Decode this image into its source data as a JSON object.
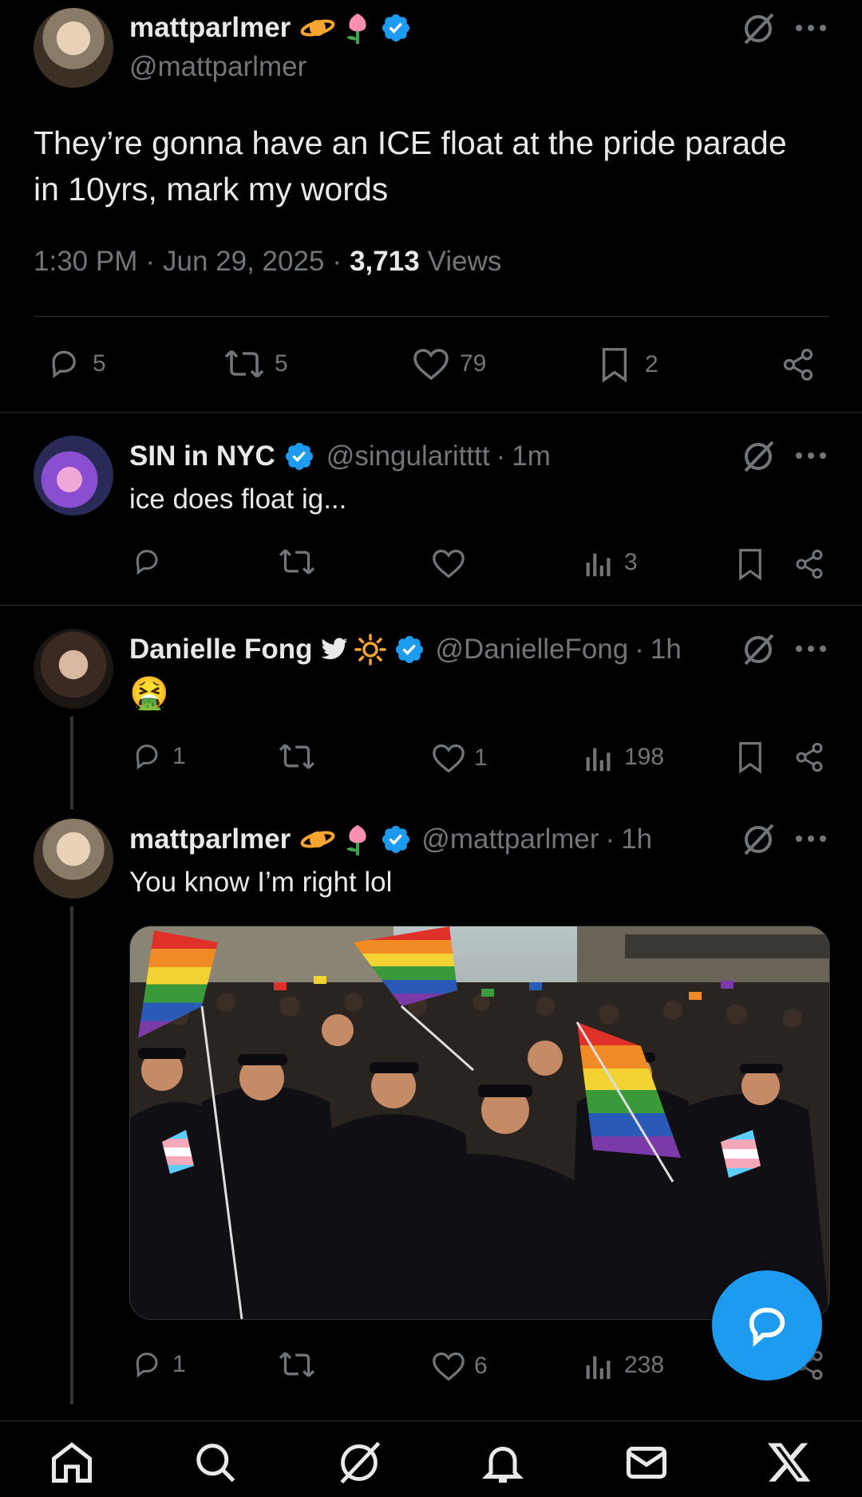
{
  "main_post": {
    "name": "mattparlmer",
    "handle": "@mattparlmer",
    "text_line1": "They’re gonna have an ICE float at the pride parade",
    "text_line2": "in 10yrs, mark my words",
    "time": "1:30 PM",
    "date": "Jun 29, 2025",
    "views_count": "3,713",
    "views_label": "Views",
    "replies": "5",
    "reposts": "5",
    "likes": "79",
    "bookmarks": "2"
  },
  "replies": [
    {
      "name": "SIN in NYC",
      "handle": "@singularitttt",
      "time": "1m",
      "text": "ice does float ig...",
      "replies": "",
      "reposts": "",
      "likes": "",
      "views": "3"
    },
    {
      "name": "Danielle Fong",
      "handle": "@DanielleFong",
      "time": "1h",
      "text": "🤮",
      "replies": "1",
      "reposts": "",
      "likes": "1",
      "views": "198"
    },
    {
      "name": "mattparlmer",
      "handle": "@mattparlmer",
      "time": "1h",
      "text": "You know I’m right lol",
      "replies": "1",
      "reposts": "",
      "likes": "6",
      "views": "238"
    }
  ],
  "colors": {
    "background": "#000000",
    "verified": "#1d9bf0",
    "muted": "#71767b",
    "divider": "#2f3336",
    "fab": "#1d9bf0"
  },
  "icons": {
    "saturn": "ringed-planet-emoji",
    "tulip": "tulip-emoji",
    "bird": "bird-icon",
    "sun": "sun-icon",
    "verified": "verified-badge",
    "grok": "grok-icon",
    "more": "more-icon"
  },
  "nav": [
    "home",
    "search",
    "grok",
    "notifications",
    "messages",
    "x"
  ]
}
